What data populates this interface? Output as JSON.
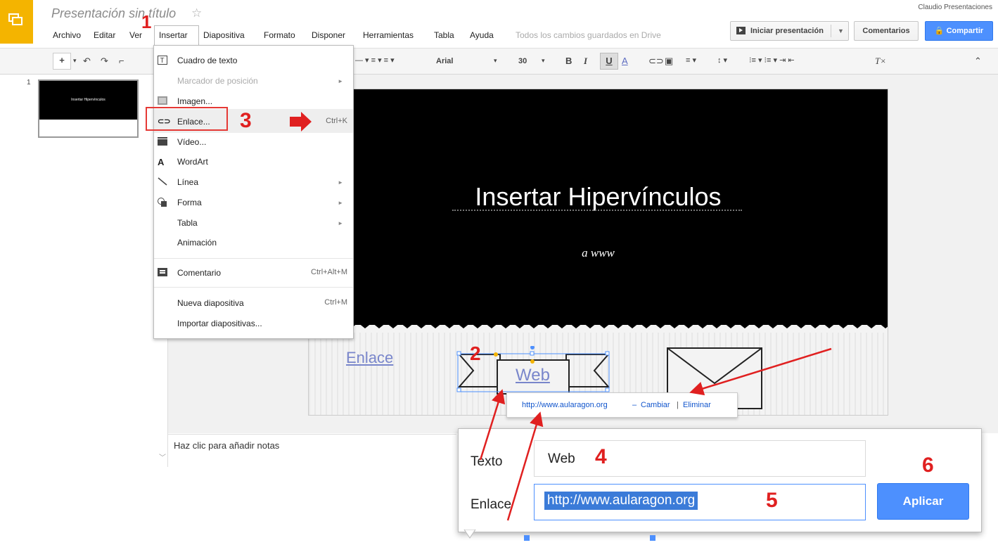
{
  "header": {
    "doc_title": "Presentación sin título",
    "user": "Claudio Presentaciones",
    "save_status": "Todos los cambios guardados en Drive",
    "start_label": "Iniciar presentación",
    "comments_label": "Comentarios",
    "share_label": "Compartir"
  },
  "menubar": [
    "Archivo",
    "Editar",
    "Ver",
    "Insertar",
    "Diapositiva",
    "Formato",
    "Disponer",
    "Herramientas",
    "Tabla",
    "Ayuda"
  ],
  "toolbar": {
    "font": "Arial",
    "size": "30",
    "bold": "B",
    "italic": "I",
    "underline": "U",
    "color": "A"
  },
  "filmstrip": {
    "slide_number": "1",
    "thumb_title": "Insertar Hipervínculos"
  },
  "slide": {
    "title": "Insertar Hipervínculos",
    "subtitle": "a        www",
    "link_text": "Enlace",
    "web_text": "Web"
  },
  "notes_placeholder": "Haz clic para añadir notas",
  "insert_menu": {
    "text_box": "Cuadro de texto",
    "placeholder": "Marcador de posición",
    "image": "Imagen...",
    "link": "Enlace...",
    "link_shortcut": "Ctrl+K",
    "video": "Vídeo...",
    "wordart": "WordArt",
    "line": "Línea",
    "shape": "Forma",
    "table": "Tabla",
    "animation": "Animación",
    "comment": "Comentario",
    "comment_shortcut": "Ctrl+Alt+M",
    "new_slide": "Nueva diapositiva",
    "new_slide_shortcut": "Ctrl+M",
    "import_slides": "Importar diapositivas..."
  },
  "link_tooltip": {
    "url": "http://www.aularagon.org",
    "dash": "–",
    "change": "Cambiar",
    "bar": "|",
    "remove": "Eliminar"
  },
  "link_dialog": {
    "text_label": "Texto",
    "text_value": "Web",
    "link_label": "Enlace",
    "link_value": "http://www.aularagon.org",
    "apply_label": "Aplicar"
  },
  "annotations": [
    "1",
    "2",
    "3",
    "4",
    "5",
    "6"
  ],
  "colors": {
    "accent": "#4d90fe",
    "logo": "#f4b400",
    "annotation": "#e02020"
  }
}
